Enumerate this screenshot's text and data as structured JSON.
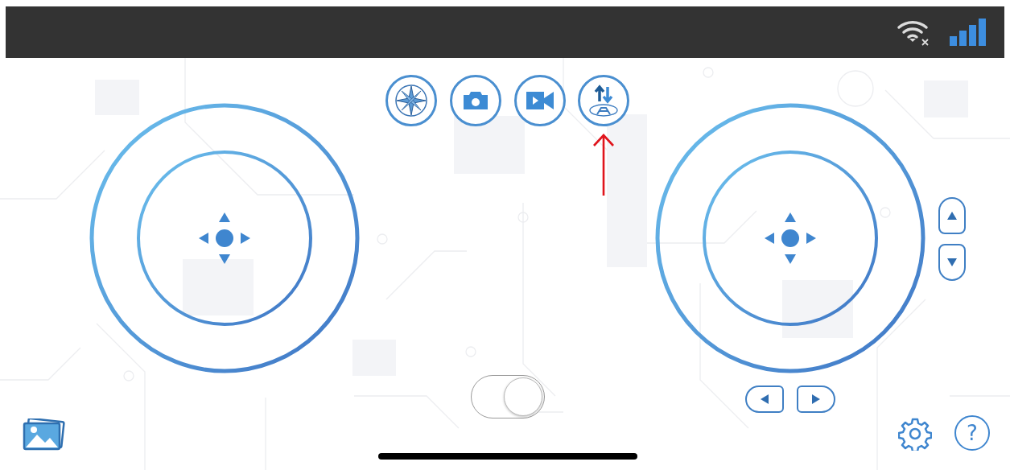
{
  "status_bar": {
    "wifi": {
      "connected": false
    },
    "signal": {
      "kind": "cellular"
    }
  },
  "toolbar": [
    {
      "kind": "compass"
    },
    {
      "kind": "camera"
    },
    {
      "kind": "video"
    },
    {
      "kind": "flip"
    }
  ],
  "mode_toggle": {
    "on": true
  },
  "help_button": {
    "label": "?"
  }
}
